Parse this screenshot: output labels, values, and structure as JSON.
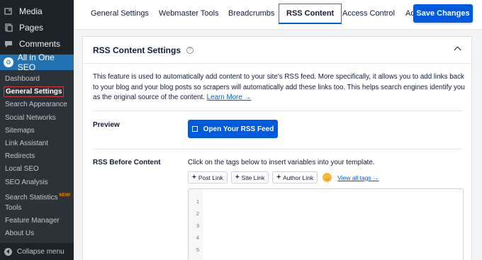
{
  "sidebar": {
    "top_items": [
      {
        "label": "Media",
        "icon": "media-icon"
      },
      {
        "label": "Pages",
        "icon": "pages-icon"
      },
      {
        "label": "Comments",
        "icon": "comments-icon"
      }
    ],
    "plugin_label": "All in One SEO",
    "submenu": [
      "Dashboard",
      "General Settings",
      "Search Appearance",
      "Social Networks",
      "Sitemaps",
      "Link Assistant",
      "Redirects",
      "Local SEO",
      "SEO Analysis",
      "Search Statistics",
      "Tools",
      "Feature Manager",
      "About Us"
    ],
    "new_badge": "NEW!",
    "collapse_label": "Collapse menu"
  },
  "tabs": [
    "General Settings",
    "Webmaster Tools",
    "Breadcrumbs",
    "RSS Content",
    "Access Control",
    "Ad"
  ],
  "save_label": "Save Changes",
  "card": {
    "title": "RSS Content Settings",
    "help_icon": "?",
    "description": "This feature is used to automatically add content to your site's RSS feed. More specifically, it allows you to add links back to your blog and your blog posts so scrapers will automatically add these links too. This helps search engines identify you as the original source of the content.",
    "learn_more": "Learn More →",
    "preview_label": "Preview",
    "open_feed_label": "Open Your RSS Feed",
    "rss_before_label": "RSS Before Content",
    "hint": "Click on the tags below to insert variables into your template.",
    "tag_buttons": [
      "Post Link",
      "Site Link",
      "Author Link"
    ],
    "view_all": "View all tags →",
    "line_numbers": [
      "1",
      "2",
      "3",
      "4",
      "5"
    ]
  },
  "colors": {
    "accent": "#005ae0",
    "sidebar_bg": "#1d2327",
    "active_menu": "#2271b1",
    "highlight_border": "#d63638"
  }
}
